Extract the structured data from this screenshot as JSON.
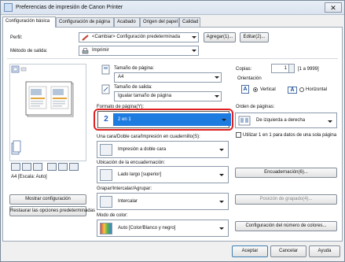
{
  "window": {
    "title": "Preferencias de impresión de Canon Printer",
    "close_glyph": "✕"
  },
  "tabs": [
    {
      "label": "Configuración básica"
    },
    {
      "label": "Configuración de página"
    },
    {
      "label": "Acabado"
    },
    {
      "label": "Origen del papel"
    },
    {
      "label": "Calidad"
    }
  ],
  "profile": {
    "label": "Perfil:",
    "value": "<Cambiar> Configuración predeterminada",
    "add_button": "Agregar(1)...",
    "edit_button": "Editar(2)..."
  },
  "output_method": {
    "label": "Método de salida:",
    "value": "Imprimir"
  },
  "preview": {
    "caption": "A4 [Escala: Auto]"
  },
  "page_size": {
    "label": "Tamaño de página:",
    "value": "A4"
  },
  "output_size": {
    "label": "Tamaño de salida:",
    "value": "Igualar tamaño de página"
  },
  "copies": {
    "label": "Copias:",
    "value": "1",
    "range": "[1 a 9999]"
  },
  "orientation": {
    "label": "Orientación",
    "portrait_label": "Vertical",
    "landscape_label": "Horizontal",
    "selected": "portrait"
  },
  "page_layout": {
    "label": "Formato de página(Y):",
    "value": "2 en 1",
    "icon_number": "2"
  },
  "page_order": {
    "label": "Orden de páginas:",
    "value": "De izquierda a derecha"
  },
  "use_1on1": {
    "label": "Utilizar 1 en 1 para datos de una sola página",
    "checked": false
  },
  "duplex": {
    "label": "Una cara/Doble cara/Impresión en cuadernillo(S):",
    "value": "Impresión a doble cara"
  },
  "binding": {
    "label": "Ubicación de la encuadernación:",
    "value": "Lado largo [superior]",
    "button": "Encuadernación(6)..."
  },
  "staple": {
    "label": "Grapar/Intercalar/Agrupar:",
    "value": "Intercalar",
    "button": "Posición de grapado(4)..."
  },
  "color_mode": {
    "label": "Modo de color:",
    "value": "Auto [Color/Blanco y negro]",
    "button": "Configuración del número de colores..."
  },
  "left_buttons": {
    "show_settings": "Mostrar configuración",
    "restore_defaults": "Restaurar las opciones predeterminadas"
  },
  "footer": {
    "ok": "Aceptar",
    "cancel": "Cancelar",
    "help": "Ayuda"
  },
  "colors": {
    "selection_blue": "#1e7be0",
    "highlight_red": "#e02020"
  }
}
